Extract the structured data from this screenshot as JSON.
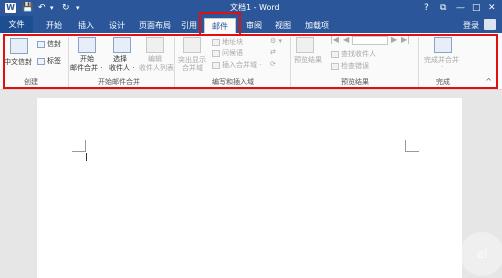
{
  "titlebar": {
    "doc_title": "文档1 - Word",
    "help": "?",
    "minimize": "—",
    "restore": "□",
    "close": "✕",
    "ribbon_opts": "⧉",
    "qat_save": "💾",
    "qat_undo": "↶",
    "qat_redo": "↻",
    "qat_more": "▾"
  },
  "tabs": {
    "file": "文件",
    "home": "开始",
    "insert": "插入",
    "design": "设计",
    "layout": "页面布局",
    "references": "引用",
    "mailings": "邮件",
    "review": "审阅",
    "view": "视图",
    "addins": "加载项",
    "login": "登录"
  },
  "ribbon": {
    "create": {
      "chinese_envelope": "中文信封",
      "envelope": "信封",
      "labels": "标签",
      "group": "创建"
    },
    "start_merge": {
      "start_line1": "开始",
      "start_line2": "邮件合并 ·",
      "select_line1": "选择",
      "select_line2": "收件人 ·",
      "edit_line1": "编辑",
      "edit_line2": "收件人列表",
      "group": "开始邮件合并"
    },
    "write_insert": {
      "highlight_line1": "突出显示",
      "highlight_line2": "合并域",
      "address_block": "地址块",
      "greeting_line": "问候语",
      "insert_field": "插入合并域 ·",
      "group": "编写和插入域"
    },
    "preview": {
      "preview_results": "预览结果",
      "find_recipient": "查找收件人",
      "check_errors": "检查错误",
      "group": "预览结果"
    },
    "finish": {
      "finish_merge_line1": "完成并合并",
      "finish_merge_line2": "·",
      "group": "完成"
    },
    "collapse": "^"
  },
  "watermark": "el"
}
